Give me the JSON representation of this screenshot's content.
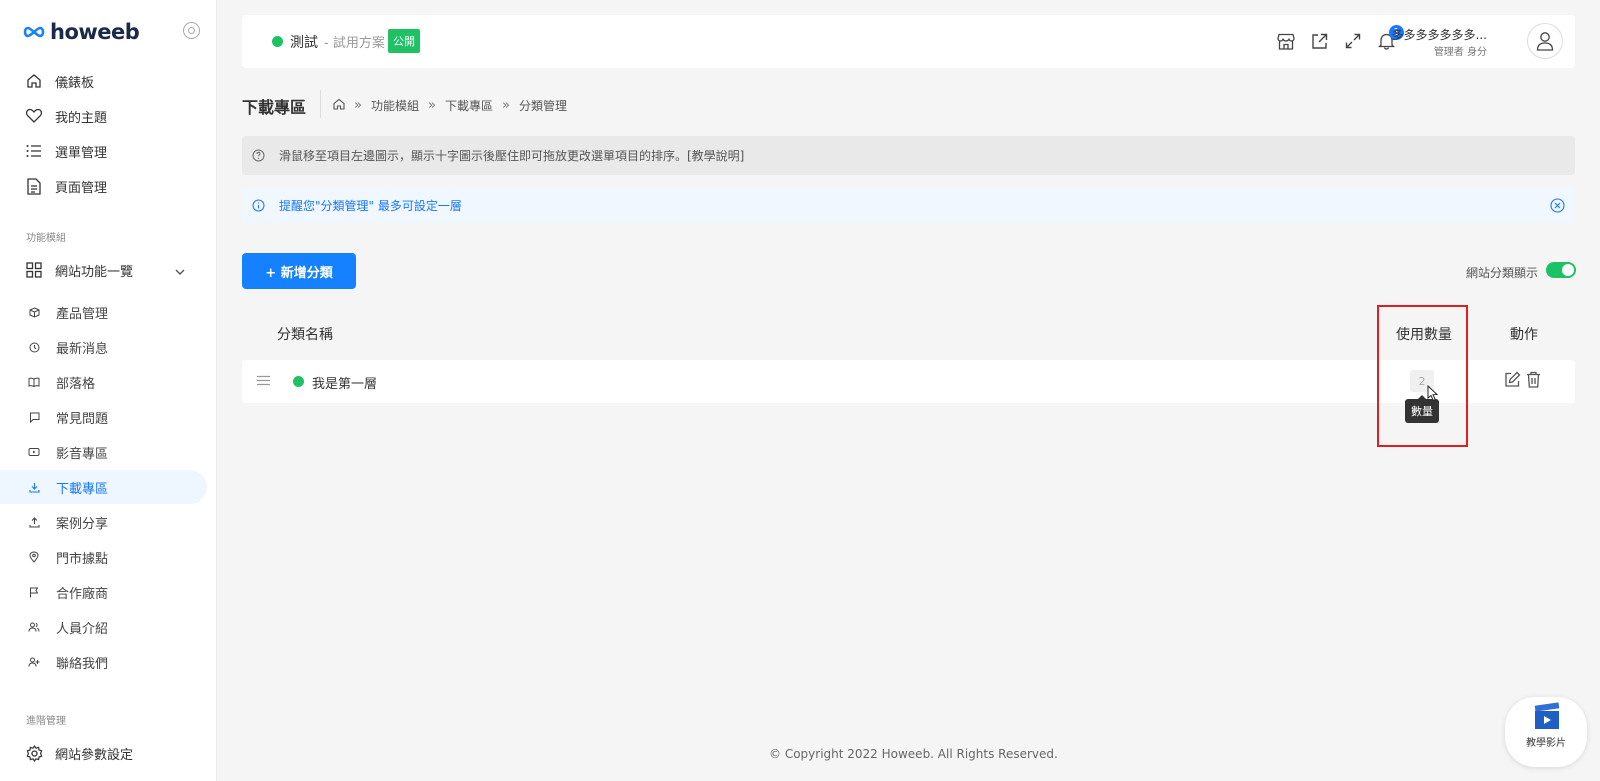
{
  "brand": {
    "logo_text": "howeeb"
  },
  "sidebar": {
    "top_items": [
      {
        "label": "儀錶板",
        "icon": "home-icon"
      },
      {
        "label": "我的主題",
        "icon": "heart-icon"
      },
      {
        "label": "選單管理",
        "icon": "list-icon"
      },
      {
        "label": "頁面管理",
        "icon": "document-icon"
      }
    ],
    "section_modules": "功能模組",
    "module_group": {
      "label": "網站功能一覽",
      "icon": "grid-icon"
    },
    "sub_items": [
      {
        "label": "產品管理",
        "icon": "box-icon"
      },
      {
        "label": "最新消息",
        "icon": "clock-icon"
      },
      {
        "label": "部落格",
        "icon": "book-icon"
      },
      {
        "label": "常見問題",
        "icon": "chat-icon"
      },
      {
        "label": "影音專區",
        "icon": "video-icon"
      },
      {
        "label": "下載專區",
        "icon": "download-icon",
        "active": true
      },
      {
        "label": "案例分享",
        "icon": "share-icon"
      },
      {
        "label": "門市據點",
        "icon": "location-icon"
      },
      {
        "label": "合作廠商",
        "icon": "flag-icon"
      },
      {
        "label": "人員介紹",
        "icon": "users-icon"
      },
      {
        "label": "聯絡我們",
        "icon": "contact-icon"
      }
    ],
    "section_advanced": "進階管理",
    "settings_item": {
      "label": "網站參數設定",
      "icon": "gear-icon"
    }
  },
  "header": {
    "site_name": "測試",
    "plan": "- 試用方案",
    "public_badge": "公開",
    "notification_count": "1",
    "user_name": "多多多多多多多...",
    "user_role": "管理者 身分"
  },
  "page": {
    "title": "下載專區",
    "breadcrumb": [
      "功能模組",
      "下載專區",
      "分類管理"
    ]
  },
  "tip_text": "滑鼠移至項目左邊圖示，顯示十字圖示後壓住即可拖放更改選單項目的排序。[教學說明]",
  "note_text": "提醒您\"分類管理\" 最多可設定一層",
  "add_button": "+ 新增分類",
  "toggle_label": "網站分類顯示",
  "table": {
    "headers": {
      "name": "分類名稱",
      "count": "使用數量",
      "action": "動作"
    },
    "rows": [
      {
        "name": "我是第一層",
        "count": "2"
      }
    ]
  },
  "tooltip": "數量",
  "footer": "© Copyright 2022 Howeeb. All Rights Reserved.",
  "video_widget": "教學影片"
}
